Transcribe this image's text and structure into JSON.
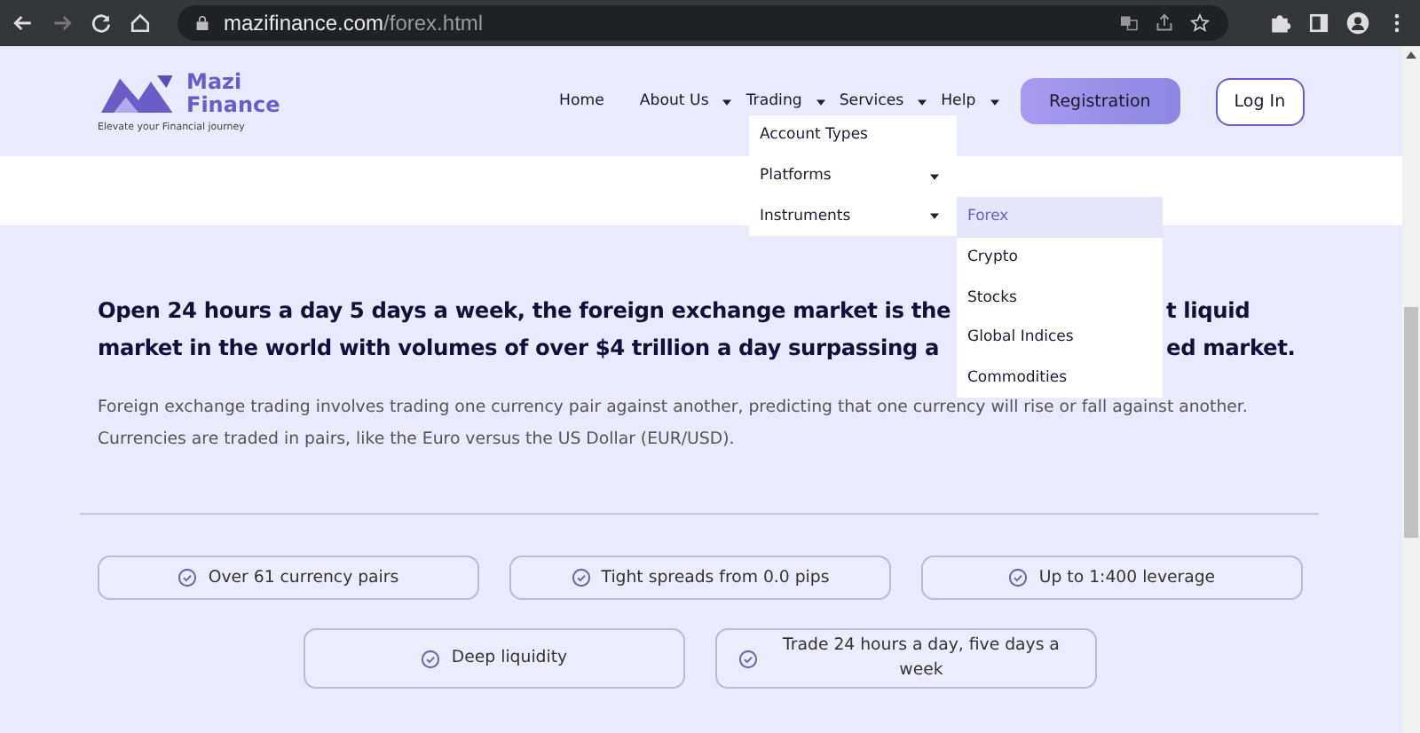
{
  "browser": {
    "url_domain": "mazifinance.com",
    "url_path": "/forex.html"
  },
  "logo": {
    "name_line1": "Mazi",
    "name_line2": "Finance",
    "tagline": "Elevate your Financial journey"
  },
  "nav": [
    {
      "label": "Home",
      "has_caret": false
    },
    {
      "label": "About Us",
      "has_caret": true
    },
    {
      "label": "Trading",
      "has_caret": true
    },
    {
      "label": "Services",
      "has_caret": true
    },
    {
      "label": "Help",
      "has_caret": true
    }
  ],
  "nav_buttons": [
    {
      "label": "Registration",
      "kind": "primary"
    },
    {
      "label": "Log In",
      "kind": "outline"
    }
  ],
  "trading_menu": [
    {
      "label": "Account Types",
      "has_caret": false
    },
    {
      "label": "Platforms",
      "has_caret": true
    },
    {
      "label": "Instruments",
      "has_caret": true
    }
  ],
  "instruments_menu": [
    {
      "label": "Forex",
      "selected": true
    },
    {
      "label": "Crypto",
      "selected": false
    },
    {
      "label": "Stocks",
      "selected": false
    },
    {
      "label": "Global Indices",
      "selected": false
    },
    {
      "label": "Commodities",
      "selected": false
    }
  ],
  "heading_lines": [
    {
      "left": "Open 24 hours a day 5 days a week, the foreign exchange market is the",
      "right": "t liquid"
    },
    {
      "left": "market in the world with volumes of over $4 trillion a day surpassing a",
      "right": "ed market."
    }
  ],
  "intro": "Foreign exchange trading involves trading one currency pair against another, predicting that one currency will rise or fall against another. Currencies are traded in pairs, like the Euro versus the US Dollar (EUR/USD).",
  "features": [
    [
      "Over 61 currency pairs",
      "Tight spreads from 0.0 pips",
      "Up to 1:400 leverage"
    ],
    [
      "Deep liquidity",
      "Trade 24 hours a day, five days a week"
    ]
  ]
}
